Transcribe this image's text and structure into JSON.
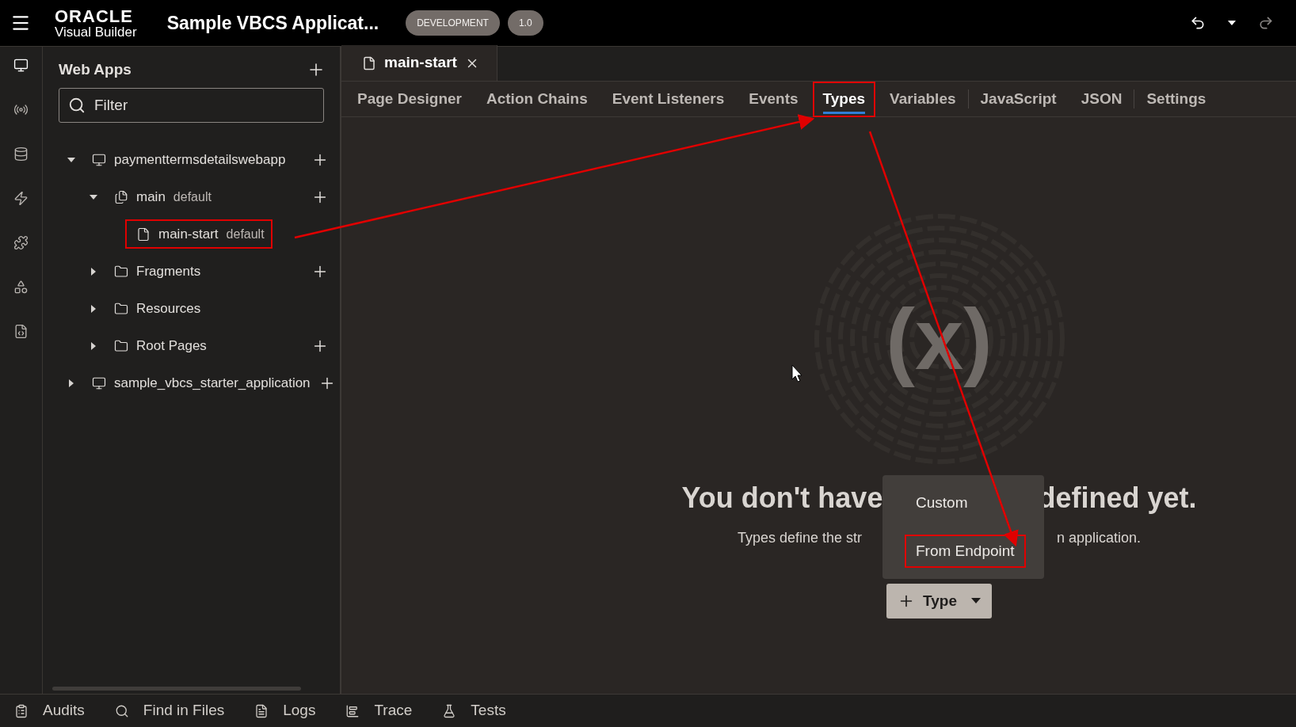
{
  "header": {
    "logo_top": "ORACLE",
    "logo_bottom": "Visual Builder",
    "app_title": "Sample VBCS Applicat...",
    "badges": [
      "DEVELOPMENT",
      "1.0"
    ],
    "undo_disabled": false,
    "redo_disabled": true
  },
  "rail": [
    {
      "kind": "monitor",
      "selected": true
    },
    {
      "kind": "service",
      "selected": false
    },
    {
      "kind": "database",
      "selected": false
    },
    {
      "kind": "bolt",
      "selected": false
    },
    {
      "kind": "puzzle",
      "selected": false
    },
    {
      "kind": "shapes",
      "selected": false
    },
    {
      "kind": "code-file",
      "selected": false
    }
  ],
  "sidebar": {
    "title": "Web Apps",
    "filter_placeholder": "Filter",
    "tree": [
      {
        "label": "paymenttermsdetailswebapp",
        "kind": "app",
        "expanded": true,
        "addable": true,
        "highlighted": false,
        "children": [
          {
            "label": "main",
            "tag": "default",
            "kind": "flow",
            "expanded": true,
            "addable": true,
            "highlighted": false,
            "children": [
              {
                "label": "main-start",
                "tag": "default",
                "kind": "page",
                "addable": false,
                "highlighted": true
              }
            ]
          },
          {
            "label": "Fragments",
            "kind": "folder",
            "expanded": false,
            "addable": true,
            "highlighted": false
          },
          {
            "label": "Resources",
            "kind": "folder",
            "expanded": false,
            "addable": false,
            "highlighted": false
          },
          {
            "label": "Root Pages",
            "kind": "folder",
            "expanded": false,
            "addable": true,
            "highlighted": false
          }
        ]
      },
      {
        "label": "sample_vbcs_starter_application",
        "kind": "app",
        "expanded": false,
        "addable": true,
        "highlighted": false
      }
    ]
  },
  "editor_tab": {
    "label": "main-start"
  },
  "tabs": [
    {
      "label": "Page Designer",
      "selected": false,
      "highlighted": false,
      "divider": false
    },
    {
      "label": "Action Chains",
      "selected": false,
      "highlighted": false,
      "divider": false
    },
    {
      "label": "Event Listeners",
      "selected": false,
      "highlighted": false,
      "divider": false
    },
    {
      "label": "Events",
      "selected": false,
      "highlighted": false,
      "divider": false
    },
    {
      "label": "Types",
      "selected": true,
      "highlighted": true,
      "divider": false
    },
    {
      "label": "Variables",
      "selected": false,
      "highlighted": false,
      "divider": false
    },
    {
      "label": "JavaScript",
      "selected": false,
      "highlighted": false,
      "divider": true
    },
    {
      "label": "JSON",
      "selected": false,
      "highlighted": false,
      "divider": false
    },
    {
      "label": "Settings",
      "selected": false,
      "highlighted": false,
      "divider": true
    }
  ],
  "empty_state": {
    "illustration_text": "(x)",
    "heading_left": "You don't have",
    "heading_right": "defined yet.",
    "text_left": "Types define the str",
    "text_right": "n application.",
    "menu": [
      {
        "label": "Custom",
        "highlighted": false
      },
      {
        "label": "From Endpoint",
        "highlighted": true
      }
    ],
    "button": "Type"
  },
  "bottom_bar": [
    {
      "label": "Audits",
      "kind": "audits"
    },
    {
      "label": "Find in Files",
      "kind": "search"
    },
    {
      "label": "Logs",
      "kind": "logs"
    },
    {
      "label": "Trace",
      "kind": "trace"
    },
    {
      "label": "Tests",
      "kind": "tests"
    }
  ]
}
